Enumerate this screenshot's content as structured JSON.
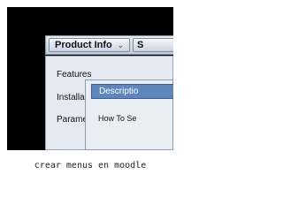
{
  "menubar": {
    "item_1": {
      "label": "Product Info",
      "chevron": "⌄"
    },
    "item_2": {
      "label": "S"
    }
  },
  "dropdown": {
    "items": [
      "Features",
      "Installa",
      "Parame"
    ]
  },
  "submenu": {
    "highlighted": "Descriptio",
    "item": "How To Se"
  },
  "caption": "crear menus en moodle"
}
